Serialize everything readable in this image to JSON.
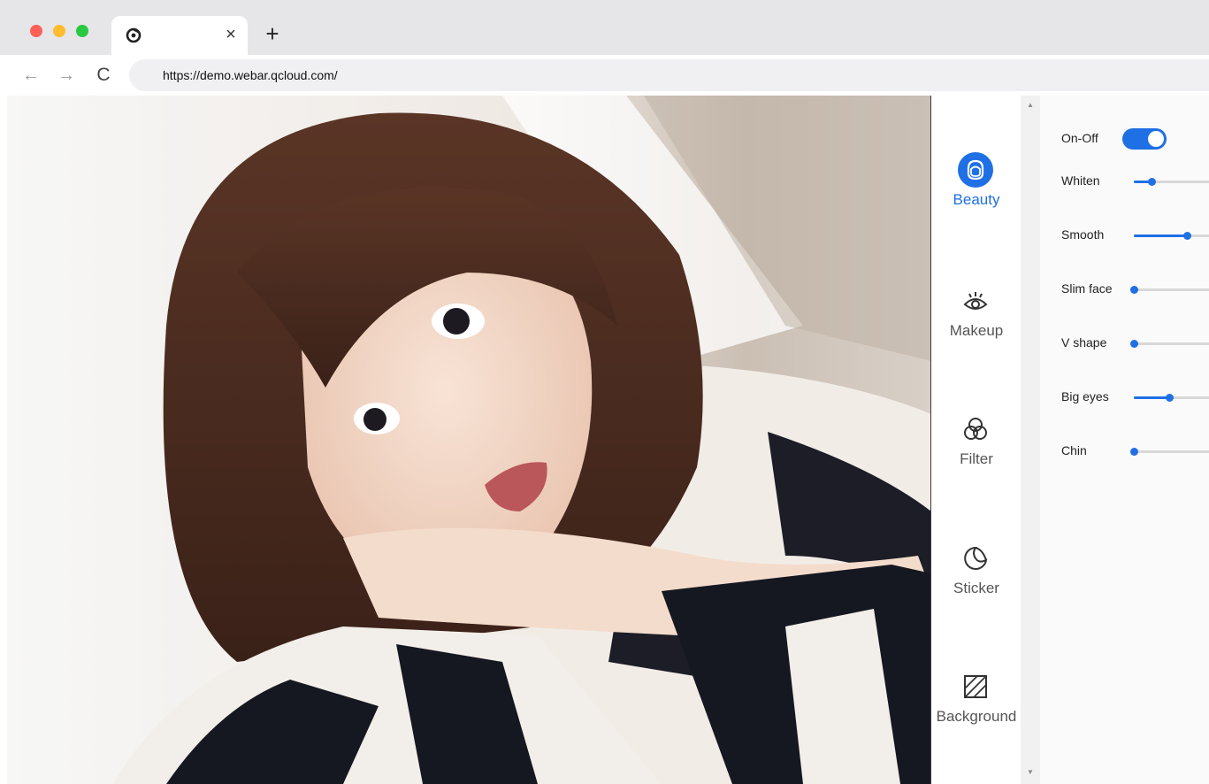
{
  "browser": {
    "tab_close": "×",
    "new_tab": "+",
    "back": "←",
    "forward": "→",
    "reload": "C",
    "url": "https://demo.webar.qcloud.com/"
  },
  "sidebar": {
    "items": [
      {
        "label": "Beauty",
        "icon": "face-icon",
        "active": true
      },
      {
        "label": "Makeup",
        "icon": "eye-icon",
        "active": false
      },
      {
        "label": "Filter",
        "icon": "filter-circles-icon",
        "active": false
      },
      {
        "label": "Sticker",
        "icon": "sticker-icon",
        "active": false
      },
      {
        "label": "Background",
        "icon": "background-icon",
        "active": false
      }
    ]
  },
  "panel": {
    "toggle": {
      "label": "On-Off",
      "on": true
    },
    "sliders": [
      {
        "label": "Whiten",
        "value": 0.17
      },
      {
        "label": "Smooth",
        "value": 0.5
      },
      {
        "label": "Slim face",
        "value": 0.0
      },
      {
        "label": "V shape",
        "value": 0.0
      },
      {
        "label": "Big eyes",
        "value": 0.33
      },
      {
        "label": "Chin",
        "value": 0.0
      }
    ]
  },
  "colors": {
    "accent": "#1f6fe5",
    "tabbar": "#e6e6e8",
    "close_red": "#fe5f57",
    "minimize_yellow": "#febc2e",
    "zoom_green": "#28c840"
  }
}
